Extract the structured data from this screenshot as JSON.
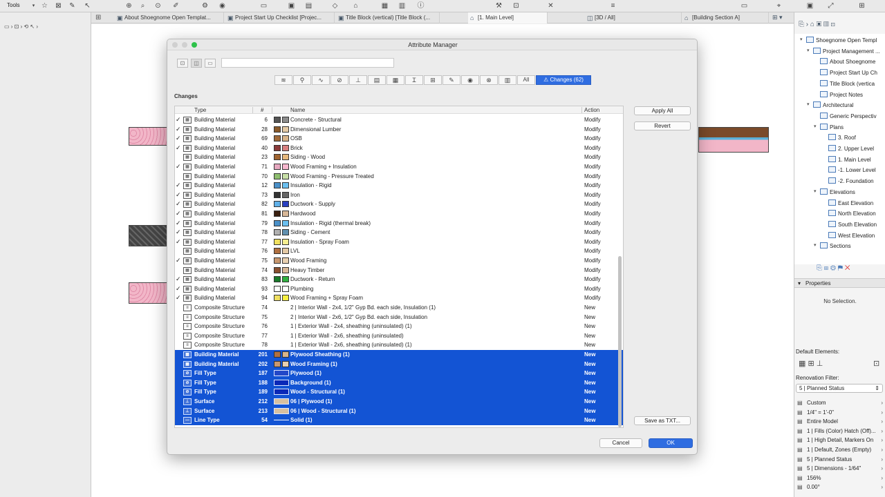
{
  "toolbar": {
    "tools_label": "Tools"
  },
  "tabs": [
    {
      "label": "About Shoegnome Open Templat...",
      "active": false,
      "icon": "layout-icon"
    },
    {
      "label": "Project Start Up Checklist [Projec...",
      "active": false,
      "icon": "layout-icon"
    },
    {
      "label": "Title Block (vertical) [Title Block (...",
      "active": false,
      "icon": "layout-icon"
    },
    {
      "label": "[1. Main Level]",
      "active": true,
      "icon": "floor-plan-icon"
    },
    {
      "label": "[3D / All]",
      "active": false,
      "icon": "3d-view-icon"
    },
    {
      "label": "[Building Section A]",
      "active": false,
      "icon": "section-icon"
    }
  ],
  "navigator": {
    "items": [
      {
        "label": "Shoegnome Open Templ",
        "level": 0,
        "arrow": "down"
      },
      {
        "label": "Project Management ...",
        "level": 1,
        "arrow": "down"
      },
      {
        "label": "About Shoegnome",
        "level": 2,
        "arrow": ""
      },
      {
        "label": "Project Start Up Ch",
        "level": 2,
        "arrow": ""
      },
      {
        "label": "Title Block (vertica",
        "level": 2,
        "arrow": ""
      },
      {
        "label": "Project Notes",
        "level": 2,
        "arrow": ""
      },
      {
        "label": "Architectural",
        "level": 1,
        "arrow": "down"
      },
      {
        "label": "Generic Perspectiv",
        "level": 2,
        "arrow": ""
      },
      {
        "label": "Plans",
        "level": 2,
        "arrow": "down"
      },
      {
        "label": "3. Roof",
        "level": 3,
        "arrow": ""
      },
      {
        "label": "2. Upper Level",
        "level": 3,
        "arrow": ""
      },
      {
        "label": "1. Main Level",
        "level": 3,
        "arrow": ""
      },
      {
        "label": "-1. Lower Level",
        "level": 3,
        "arrow": ""
      },
      {
        "label": "-2. Foundation",
        "level": 3,
        "arrow": ""
      },
      {
        "label": "Elevations",
        "level": 2,
        "arrow": "down"
      },
      {
        "label": "East Elevation",
        "level": 3,
        "arrow": ""
      },
      {
        "label": "North Elevation",
        "level": 3,
        "arrow": ""
      },
      {
        "label": "South Elevation",
        "level": 3,
        "arrow": ""
      },
      {
        "label": "West Elevation",
        "level": 3,
        "arrow": ""
      },
      {
        "label": "Sections",
        "level": 2,
        "arrow": "down"
      }
    ],
    "properties_label": "Properties",
    "no_selection": "No Selection.",
    "default_elements_label": "Default Elements:",
    "renovation_filter_label": "Renovation Filter:",
    "renovation_filter_value": "5 | Planned Status",
    "quick_options": [
      {
        "label": "Custom",
        "icon": "layers-icon"
      },
      {
        "label": "1/4\"   =   1'-0\"",
        "icon": "scale-icon"
      },
      {
        "label": "Entire Model",
        "icon": "structure-icon"
      },
      {
        "label": "1 | Fills (Color) Hatch (Off)...",
        "icon": "pen-icon"
      },
      {
        "label": "1 | High Detail, Markers On",
        "icon": "model-view-icon"
      },
      {
        "label": "1 | Default, Zones (Empty)",
        "icon": "graphic-override-icon"
      },
      {
        "label": "5 | Planned Status",
        "icon": "renovation-icon"
      },
      {
        "label": "5 | Dimensions - 1/64\"",
        "icon": "dimension-icon"
      },
      {
        "label": "156%",
        "icon": "zoom-icon"
      },
      {
        "label": "0.00°",
        "icon": "rotation-icon"
      }
    ]
  },
  "dialog": {
    "title": "Attribute Manager",
    "search_placeholder": "",
    "filters": [
      {
        "icon": "layers-icon",
        "label": "≋"
      },
      {
        "icon": "pen-icon",
        "label": "⚲"
      },
      {
        "icon": "line-type-icon",
        "label": "∿"
      },
      {
        "icon": "fill-icon",
        "label": "⊘"
      },
      {
        "icon": "composite-icon",
        "label": "⊥"
      },
      {
        "icon": "profile-icon",
        "label": "▤"
      },
      {
        "icon": "zone-icon",
        "label": "▦"
      },
      {
        "icon": "building-material-icon",
        "label": "Ɪ"
      },
      {
        "icon": "surface-icon",
        "label": "⊞"
      },
      {
        "icon": "markup-icon",
        "label": "✎"
      },
      {
        "icon": "location-icon",
        "label": "◉"
      },
      {
        "icon": "renovation-icon",
        "label": "⊗"
      },
      {
        "icon": "mep-icon",
        "label": "▥"
      }
    ],
    "filter_all": "All",
    "filter_changes": "⚠ Changes (62)",
    "changes_label": "Changes",
    "columns": {
      "type": "Type",
      "num": "#",
      "name": "Name",
      "action": "Action"
    },
    "rows": [
      {
        "check": true,
        "type": "Building Material",
        "num": "6",
        "name": "Concrete - Structural",
        "action": "Modify",
        "c1": "#555555",
        "c2": "#8c8c8c"
      },
      {
        "check": true,
        "type": "Building Material",
        "num": "28",
        "name": "Dimensional Lumber",
        "action": "Modify",
        "c1": "#8a5a2b",
        "c2": "#e3c9a4"
      },
      {
        "check": true,
        "type": "Building Material",
        "num": "69",
        "name": "OSB",
        "action": "Modify",
        "c1": "#a06a3a",
        "c2": "#d8b48a"
      },
      {
        "check": true,
        "type": "Building Material",
        "num": "40",
        "name": "Brick",
        "action": "Modify",
        "c1": "#8b3a3a",
        "c2": "#d98080"
      },
      {
        "check": false,
        "type": "Building Material",
        "num": "23",
        "name": "Siding - Wood",
        "action": "Modify",
        "c1": "#a06430",
        "c2": "#e6b87c"
      },
      {
        "check": true,
        "type": "Building Material",
        "num": "71",
        "name": "Wood Framing + Insulation",
        "action": "Modify",
        "c1": "#e6a8c0",
        "c2": "#f7b8cf"
      },
      {
        "check": false,
        "type": "Building Material",
        "num": "70",
        "name": "Wood Framing - Pressure Treated",
        "action": "Modify",
        "c1": "#8fbf70",
        "c2": "#c8e0a8"
      },
      {
        "check": true,
        "type": "Building Material",
        "num": "12",
        "name": "Insulation - Rigid",
        "action": "Modify",
        "c1": "#4a90c8",
        "c2": "#6cc0f0"
      },
      {
        "check": true,
        "type": "Building Material",
        "num": "73",
        "name": "Iron",
        "action": "Modify",
        "c1": "#333333",
        "c2": "#666666"
      },
      {
        "check": true,
        "type": "Building Material",
        "num": "82",
        "name": "Ductwork - Supply",
        "action": "Modify",
        "c1": "#60b0e8",
        "c2": "#2a40c0"
      },
      {
        "check": true,
        "type": "Building Material",
        "num": "81",
        "name": "Hardwood",
        "action": "Modify",
        "c1": "#3a2010",
        "c2": "#d8b898"
      },
      {
        "check": true,
        "type": "Building Material",
        "num": "79",
        "name": "Insulation - Rigid (thermal break)",
        "action": "Modify",
        "c1": "#4a90c8",
        "c2": "#6cc0f0"
      },
      {
        "check": true,
        "type": "Building Material",
        "num": "78",
        "name": "Siding - Cement",
        "action": "Modify",
        "c1": "#b0b0b0",
        "c2": "#6090b0"
      },
      {
        "check": true,
        "type": "Building Material",
        "num": "77",
        "name": "Insulation - Spray Foam",
        "action": "Modify",
        "c1": "#f0e060",
        "c2": "#f5ee90"
      },
      {
        "check": false,
        "type": "Building Material",
        "num": "76",
        "name": "LVL",
        "action": "Modify",
        "c1": "#b07040",
        "c2": "#e3c9a4"
      },
      {
        "check": true,
        "type": "Building Material",
        "num": "75",
        "name": "Wood Framing",
        "action": "Modify",
        "c1": "#c89870",
        "c2": "#e8d0b0"
      },
      {
        "check": false,
        "type": "Building Material",
        "num": "74",
        "name": "Heavy Timber",
        "action": "Modify",
        "c1": "#8a5030",
        "c2": "#d8b898"
      },
      {
        "check": true,
        "type": "Building Material",
        "num": "83",
        "name": "Ductwork - Return",
        "action": "Modify",
        "c1": "#1a7a2a",
        "c2": "#30b040"
      },
      {
        "check": true,
        "type": "Building Material",
        "num": "93",
        "name": "Plumbing",
        "action": "Modify",
        "c1": "#ffffff",
        "c2": "#ffffff"
      },
      {
        "check": true,
        "type": "Building Material",
        "num": "94",
        "name": "Wood Framing + Spray Foam",
        "action": "Modify",
        "c1": "#f0e060",
        "c2": "#f8f040"
      },
      {
        "check": false,
        "type": "Composite Structure",
        "num": "74",
        "name": "2 | Interior Wall - 2x4, 1/2\" Gyp Bd. each side, Insulation (1)",
        "action": "New",
        "c1": "",
        "c2": ""
      },
      {
        "check": false,
        "type": "Composite Structure",
        "num": "75",
        "name": "2 | Interior Wall - 2x6, 1/2\" Gyp Bd. each side, Insulation",
        "action": "New",
        "c1": "",
        "c2": ""
      },
      {
        "check": false,
        "type": "Composite Structure",
        "num": "76",
        "name": "1 | Exterior Wall - 2x4, sheathing (uninsulated) (1)",
        "action": "New",
        "c1": "",
        "c2": ""
      },
      {
        "check": false,
        "type": "Composite Structure",
        "num": "77",
        "name": "1 | Exterior Wall - 2x6, sheathing (uninsulated)",
        "action": "New",
        "c1": "",
        "c2": ""
      },
      {
        "check": false,
        "type": "Composite Structure",
        "num": "78",
        "name": "1 | Exterior Wall - 2x6, sheathing (uninsulated) (1)",
        "action": "New",
        "c1": "",
        "c2": ""
      },
      {
        "check": false,
        "type": "Building Material",
        "num": "201",
        "name": "Plywood Sheathing (1)",
        "action": "New",
        "c1": "#b07040",
        "c2": "#d8b48a",
        "selected": true
      },
      {
        "check": false,
        "type": "Building Material",
        "num": "202",
        "name": "Wood Framing (1)",
        "action": "New",
        "c1": "#c89870",
        "c2": "#e8d0b0",
        "selected": true
      },
      {
        "check": false,
        "type": "Fill Type",
        "num": "187",
        "name": "Plywood (1)",
        "action": "New",
        "fill": "#2248c8",
        "selected": true
      },
      {
        "check": false,
        "type": "Fill Type",
        "num": "188",
        "name": "Background (1)",
        "action": "New",
        "fill": "#0a28b8",
        "selected": true
      },
      {
        "check": false,
        "type": "Fill Type",
        "num": "189",
        "name": "Wood - Structural (1)",
        "action": "New",
        "fill": "#0a28b8",
        "selected": true
      },
      {
        "check": false,
        "type": "Surface",
        "num": "212",
        "name": "06 | Plywood (1)",
        "action": "New",
        "fill": "#d8c0a0",
        "selected": true
      },
      {
        "check": false,
        "type": "Surface",
        "num": "213",
        "name": "06 | Wood - Structural (1)",
        "action": "New",
        "fill": "#d8c0a0",
        "selected": true
      },
      {
        "check": false,
        "type": "Line Type",
        "num": "54",
        "name": "Solid (1)",
        "action": "New",
        "line": true,
        "selected": true
      }
    ],
    "apply_all": "Apply All",
    "revert": "Revert",
    "save_as_txt": "Save as TXT...",
    "cancel": "Cancel",
    "ok": "OK"
  }
}
